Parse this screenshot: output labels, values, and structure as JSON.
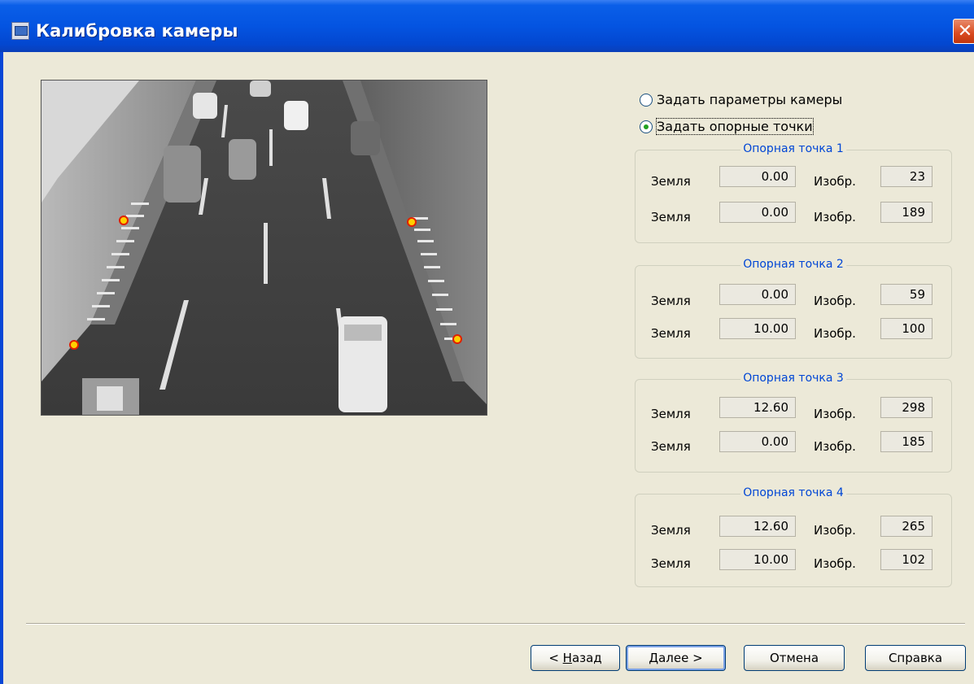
{
  "window": {
    "title": "Калибровка камеры",
    "close_glyph": "✕"
  },
  "mode": {
    "options": [
      {
        "label": "Задать параметры камеры",
        "selected": false
      },
      {
        "label": "Задать опорные точки",
        "selected": true
      }
    ]
  },
  "labels": {
    "ground": "Земля",
    "image": "Изобр."
  },
  "points": [
    {
      "title": "Опорная точка 1",
      "ground_x": "0.00",
      "image_x": "23",
      "ground_y": "0.00",
      "image_y": "189"
    },
    {
      "title": "Опорная точка 2",
      "ground_x": "0.00",
      "image_x": "59",
      "ground_y": "10.00",
      "image_y": "100"
    },
    {
      "title": "Опорная точка 3",
      "ground_x": "12.60",
      "image_x": "298",
      "ground_y": "0.00",
      "image_y": "185"
    },
    {
      "title": "Опорная точка 4",
      "ground_x": "12.60",
      "image_x": "265",
      "ground_y": "10.00",
      "image_y": "102"
    }
  ],
  "buttons": {
    "back": {
      "prefix": "< ",
      "hot": "Н",
      "rest": "азад"
    },
    "next": {
      "hot": "Д",
      "rest": "алее >"
    },
    "cancel": "Отмена",
    "help": "Справка"
  },
  "colors": {
    "titlebar": "#0454E1",
    "group_title": "#0046D5",
    "marker_fill": "#FFD000",
    "marker_ring": "#E02000"
  }
}
